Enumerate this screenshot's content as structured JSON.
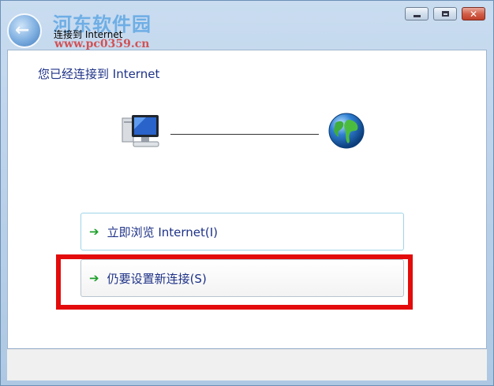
{
  "window": {
    "title": "连接到 Internet",
    "controls": {
      "minimize": "minimize-icon",
      "maximize": "maximize-icon",
      "close": "close-icon"
    }
  },
  "watermark": {
    "brand": "河东软件园",
    "url": "www.pc0359.cn"
  },
  "content": {
    "heading": "您已经连接到 Internet"
  },
  "diagram": {
    "left_icon": "computer-icon",
    "right_icon": "globe-icon"
  },
  "options": [
    {
      "label": "立即浏览 Internet(I)",
      "icon": "green-arrow-icon"
    },
    {
      "label": "仍要设置新连接(S)",
      "icon": "green-arrow-icon"
    }
  ],
  "colors": {
    "heading_text": "#1e3287",
    "arrow": "#1d9f2a",
    "highlight": "#e30b0b"
  }
}
